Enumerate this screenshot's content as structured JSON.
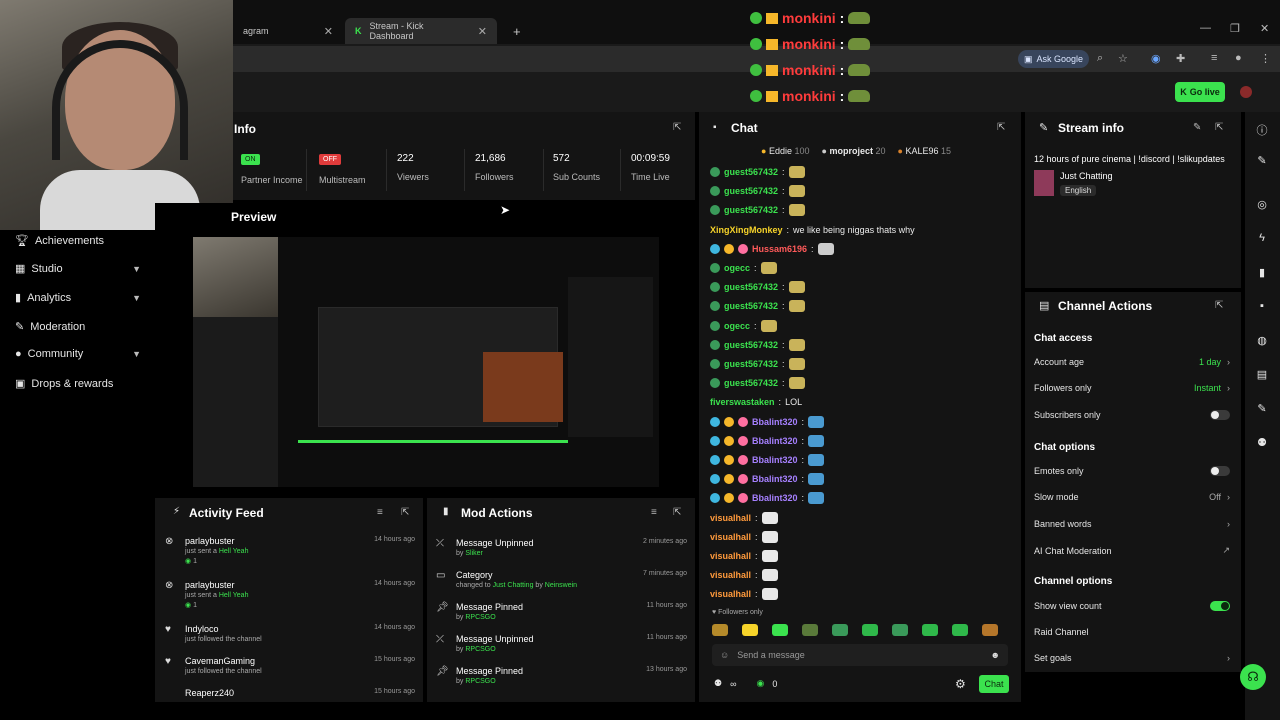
{
  "browser": {
    "tabs": [
      {
        "label": "agram",
        "active": false
      },
      {
        "label": "Stream - Kick Dashboard",
        "active": true
      }
    ],
    "new_tab": "+",
    "ask_google": "Ask Google"
  },
  "header": {
    "go_live": "Go live"
  },
  "overlay_chat": [
    {
      "name": "monkini",
      "colon": ":"
    },
    {
      "name": "monkini",
      "colon": ":"
    },
    {
      "name": "monkini",
      "colon": ":"
    },
    {
      "name": "monkini",
      "colon": ":"
    }
  ],
  "sidebar": {
    "items": [
      {
        "label": "Achievements",
        "icon": "trophy-icon",
        "chevron": false
      },
      {
        "label": "Studio",
        "icon": "studio-icon",
        "chevron": true
      },
      {
        "label": "Analytics",
        "icon": "analytics-icon",
        "chevron": true
      },
      {
        "label": "Moderation",
        "icon": "wrench-icon",
        "chevron": false
      },
      {
        "label": "Community",
        "icon": "people-icon",
        "chevron": true
      },
      {
        "label": "Drops & rewards",
        "icon": "gift-icon",
        "chevron": false
      }
    ]
  },
  "info": {
    "title": "Info",
    "stats": [
      {
        "pill": "ON",
        "label": "Partner Income"
      },
      {
        "pill": "OFF",
        "label": "Multistream"
      },
      {
        "value": "222",
        "label": "Viewers"
      },
      {
        "value": "21,686",
        "label": "Followers"
      },
      {
        "value": "572",
        "label": "Sub Counts"
      },
      {
        "value": "00:09:59",
        "label": "Time Live"
      }
    ]
  },
  "preview": {
    "title": "Preview"
  },
  "activity_feed": {
    "title": "Activity Feed",
    "items": [
      {
        "user": "parlaybuster",
        "text": "just sent a",
        "gift": "Hell Yeah",
        "count": "1",
        "ago": "14 hours ago"
      },
      {
        "user": "parlaybuster",
        "text": "just sent a",
        "gift": "Hell Yeah",
        "count": "1",
        "ago": "14 hours ago"
      },
      {
        "user": "Indyloco",
        "text": "just followed the channel",
        "ago": "14 hours ago"
      },
      {
        "user": "CavemanGaming",
        "text": "just followed the channel",
        "ago": "15 hours ago"
      },
      {
        "user": "Reaperz240",
        "text": "",
        "ago": "15 hours ago"
      }
    ]
  },
  "mod_actions": {
    "title": "Mod Actions",
    "items": [
      {
        "action": "Message Unpinned",
        "prefix": "by",
        "actor": "Sliker",
        "ago": "2 minutes ago"
      },
      {
        "action": "Category",
        "prefix": "changed to",
        "target": "Just Chatting",
        "by": "by",
        "actor": "Neinswein",
        "ago": "7 minutes ago"
      },
      {
        "action": "Message Pinned",
        "prefix": "by",
        "actor": "RPCSGO",
        "ago": "11 hours ago"
      },
      {
        "action": "Message Unpinned",
        "prefix": "by",
        "actor": "RPCSGO",
        "ago": "11 hours ago"
      },
      {
        "action": "Message Pinned",
        "prefix": "by",
        "actor": "RPCSGO",
        "ago": "13 hours ago"
      }
    ]
  },
  "chat": {
    "title": "Chat",
    "leaderboard": [
      {
        "user": "Eddie",
        "score": "100"
      },
      {
        "user": "moproject",
        "score": "20"
      },
      {
        "user": "KALE96",
        "score": "15"
      }
    ],
    "messages": [
      {
        "user": "guest567432",
        "text": "",
        "color": "green"
      },
      {
        "user": "guest567432",
        "text": "",
        "color": "green"
      },
      {
        "user": "guest567432",
        "text": "",
        "color": "green"
      },
      {
        "user": "XingXingMonkey",
        "text": "we like being niggas thats why",
        "color": "yellow"
      },
      {
        "user": "Hussam6196",
        "text": "",
        "color": "red"
      },
      {
        "user": "ogecc",
        "text": "",
        "color": "green"
      },
      {
        "user": "guest567432",
        "text": "",
        "color": "green"
      },
      {
        "user": "guest567432",
        "text": "",
        "color": "green"
      },
      {
        "user": "ogecc",
        "text": "",
        "color": "green"
      },
      {
        "user": "guest567432",
        "text": "",
        "color": "green"
      },
      {
        "user": "guest567432",
        "text": "",
        "color": "green"
      },
      {
        "user": "guest567432",
        "text": "",
        "color": "green"
      },
      {
        "user": "fiverswastaken",
        "text": "LOL",
        "color": "green"
      },
      {
        "user": "Bbalint320",
        "text": "",
        "color": "purple"
      },
      {
        "user": "Bbalint320",
        "text": "",
        "color": "purple"
      },
      {
        "user": "Bbalint320",
        "text": "",
        "color": "purple"
      },
      {
        "user": "Bbalint320",
        "text": "",
        "color": "purple"
      },
      {
        "user": "Bbalint320",
        "text": "",
        "color": "purple"
      },
      {
        "user": "visualhall",
        "text": "",
        "color": "orange"
      },
      {
        "user": "visualhall",
        "text": "",
        "color": "orange"
      },
      {
        "user": "visualhall",
        "text": "",
        "color": "orange"
      },
      {
        "user": "visualhall",
        "text": "",
        "color": "orange"
      },
      {
        "user": "visualhall",
        "text": "",
        "color": "orange"
      }
    ],
    "followers_only": "Followers only",
    "placeholder": "Send a message",
    "count": "0",
    "send_label": "Chat"
  },
  "stream_info": {
    "title": "Stream info",
    "stream_title": "12 hours of pure cinema | !discord | !slikupdates",
    "category": "Just Chatting",
    "language": "English"
  },
  "channel_actions": {
    "title": "Channel Actions",
    "chat_access": {
      "heading": "Chat access",
      "account_age": {
        "label": "Account age",
        "value": "1 day"
      },
      "followers_only": {
        "label": "Followers only",
        "value": "Instant"
      },
      "subscribers_only": {
        "label": "Subscribers only",
        "on": false
      }
    },
    "chat_options": {
      "heading": "Chat options",
      "emotes_only": {
        "label": "Emotes only",
        "on": false
      },
      "slow_mode": {
        "label": "Slow mode",
        "value": "Off"
      },
      "banned_words": {
        "label": "Banned words"
      },
      "ai_moderation": {
        "label": "AI Chat Moderation"
      }
    },
    "channel_options": {
      "heading": "Channel options",
      "show_view_count": {
        "label": "Show view count",
        "on": true
      },
      "raid_channel": {
        "label": "Raid Channel"
      },
      "set_goals": {
        "label": "Set goals"
      }
    }
  },
  "colors": {
    "accent": "#3be24e",
    "panel": "#141414",
    "danger": "#e03b3b"
  }
}
